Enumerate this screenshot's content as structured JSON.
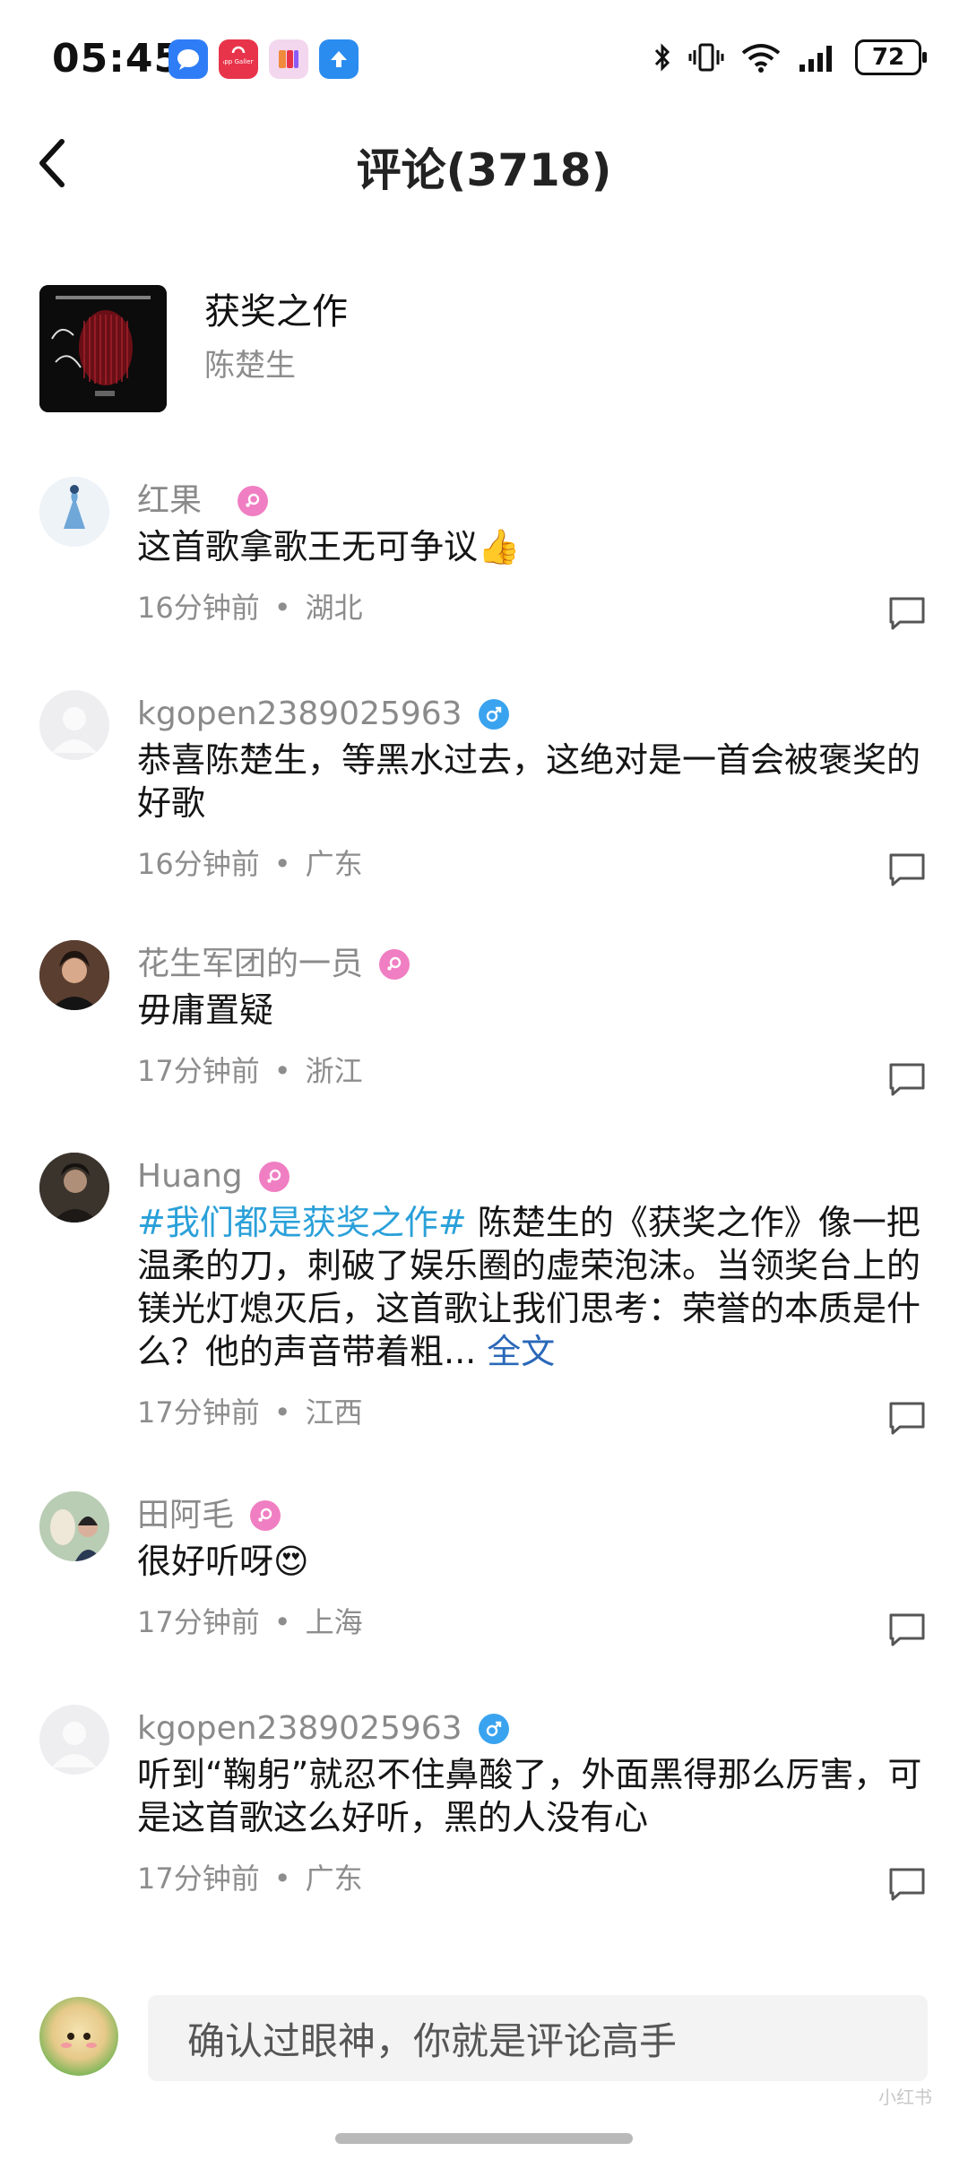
{
  "status_bar": {
    "time": "05:45",
    "app_icons": [
      "message-icon",
      "app-gallery-icon",
      "pink-app-icon",
      "upload-app-icon"
    ],
    "gallery_label": "App Gallery",
    "battery": "72"
  },
  "header": {
    "title": "评论(3718)"
  },
  "song": {
    "title": "获奖之作",
    "artist": "陈楚生"
  },
  "comments": [
    {
      "user": "红果",
      "gender": "female",
      "text": "这首歌拿歌王无可争议👍",
      "time": "16分钟前",
      "region": "湖北"
    },
    {
      "user": "kgopen2389025963",
      "gender": "male",
      "text": "恭喜陈楚生，等黑水过去，这绝对是一首会被褒奖的好歌",
      "time": "16分钟前",
      "region": "广东"
    },
    {
      "user": "花生军团的一员",
      "gender": "female",
      "text": "毋庸置疑",
      "time": "17分钟前",
      "region": "浙江"
    },
    {
      "user": "Huang",
      "gender": "female",
      "topic": "#我们都是获奖之作#",
      "text": " 陈楚生的《获奖之作》像一把温柔的刀，刺破了娱乐圈的虚荣泡沫。当领奖台上的镁光灯熄灭后，这首歌让我们思考：荣誉的本质是什么？他的声音带着粗...",
      "more": "全文",
      "time": "17分钟前",
      "region": "江西"
    },
    {
      "user": "田阿毛",
      "gender": "female",
      "text": "很好听呀😍",
      "time": "17分钟前",
      "region": "上海"
    },
    {
      "user": "kgopen2389025963",
      "gender": "male",
      "text": "听到“鞠躬”就忍不住鼻酸了，外面黑得那么厉害，可是这首歌这么好听，黑的人没有心",
      "time": "17分钟前",
      "region": "广东"
    }
  ],
  "input": {
    "placeholder": "确认过眼神，你就是评论高手"
  },
  "watermark": "小红书"
}
